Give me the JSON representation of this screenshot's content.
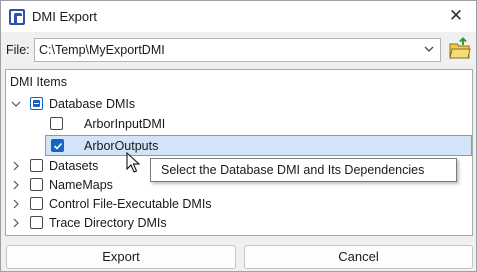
{
  "window": {
    "title": "DMI Export",
    "icon": "app-r-icon",
    "close_glyph": "✕"
  },
  "file": {
    "label": "File:",
    "value": "C:\\Temp\\MyExportDMI",
    "folder_icon": "open-folder-icon"
  },
  "tree": {
    "header": "DMI Items",
    "items": [
      {
        "label": "Database DMIs",
        "level": 0,
        "expander": "expanded",
        "check": "partial"
      },
      {
        "label": "ArborInputDMI",
        "level": 1,
        "expander": "none",
        "check": "unchecked"
      },
      {
        "label": "ArborOutputs",
        "level": 1,
        "expander": "none",
        "check": "checked",
        "selected": true
      },
      {
        "label": "Datasets",
        "level": 0,
        "expander": "collapsed",
        "check": "unchecked"
      },
      {
        "label": "NameMaps",
        "level": 0,
        "expander": "collapsed",
        "check": "unchecked"
      },
      {
        "label": "Control File-Executable DMIs",
        "level": 0,
        "expander": "collapsed",
        "check": "unchecked"
      },
      {
        "label": "Trace Directory DMIs",
        "level": 0,
        "expander": "collapsed",
        "check": "unchecked"
      }
    ]
  },
  "tooltip": {
    "text": "Select the Database DMI and Its Dependencies"
  },
  "buttons": {
    "export": "Export",
    "cancel": "Cancel"
  },
  "colors": {
    "accent": "#1565c0",
    "selection_bg": "#d3e3f8",
    "selection_border": "#6f9fd8",
    "folder_yellow": "#f2c94c",
    "folder_arrow": "#2e9e3e"
  }
}
